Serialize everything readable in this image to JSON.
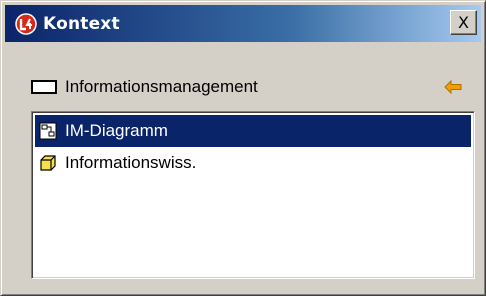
{
  "window": {
    "title": "Kontext",
    "close_glyph": "X",
    "app_icon": "red-l-logo-icon",
    "colors": {
      "titlebar_start": "#0a246a",
      "titlebar_end": "#a6caf0",
      "selection": "#0a246a",
      "face": "#d4d0c8",
      "arrow": "#f0a000"
    }
  },
  "context": {
    "label": "Informationsmanagement",
    "icon": "rectangle-icon",
    "back_icon": "left-arrow-icon"
  },
  "list": {
    "items": [
      {
        "label": "IM-Diagramm",
        "icon": "diagram-icon",
        "selected": true
      },
      {
        "label": "Informationswiss.",
        "icon": "cube-icon",
        "selected": false
      }
    ]
  }
}
